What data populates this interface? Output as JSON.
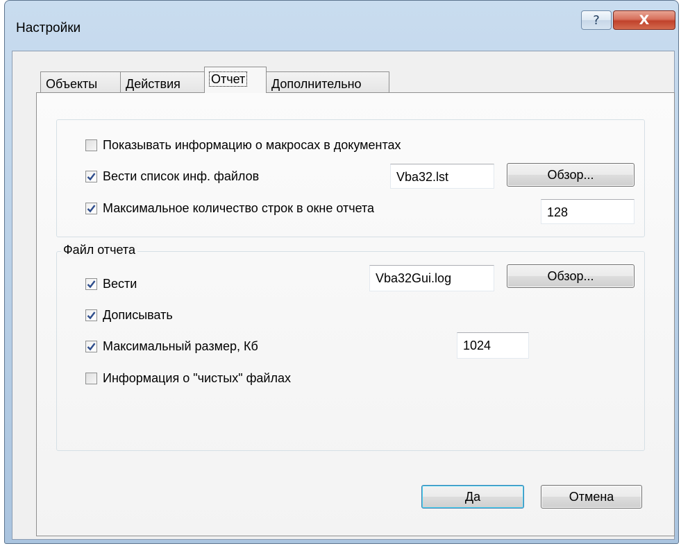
{
  "window": {
    "title": "Настройки",
    "help_label": "?",
    "close_label": "X"
  },
  "tabs": [
    {
      "label": "Объекты",
      "active": false
    },
    {
      "label": "Действия",
      "active": false
    },
    {
      "label": "Отчет",
      "active": true
    },
    {
      "label": "Дополнительно",
      "active": false
    }
  ],
  "general": {
    "show_macro_info": {
      "label": "Показывать информацию о макросах в документах",
      "checked": false
    },
    "keep_file_list": {
      "label": "Вести список инф. файлов",
      "checked": true,
      "value": "Vba32.lst"
    },
    "browse_label": "Обзор...",
    "max_lines": {
      "label": "Максимальное количество строк в окне отчета",
      "checked": true,
      "value": "128"
    }
  },
  "report_file": {
    "title": "Файл отчета",
    "keep": {
      "label": "Вести",
      "checked": true,
      "value": "Vba32Gui.log"
    },
    "browse_label": "Обзор...",
    "append": {
      "label": "Дописывать",
      "checked": true
    },
    "max_size": {
      "label": "Максимальный размер, Кб",
      "checked": true,
      "value": "1024"
    },
    "clean_files": {
      "label": "Информация о \"чистых\" файлах",
      "checked": false
    }
  },
  "buttons": {
    "ok": "Да",
    "cancel": "Отмена"
  },
  "colors": {
    "check": "#2e4d8c",
    "close_button": "#c0422b"
  }
}
